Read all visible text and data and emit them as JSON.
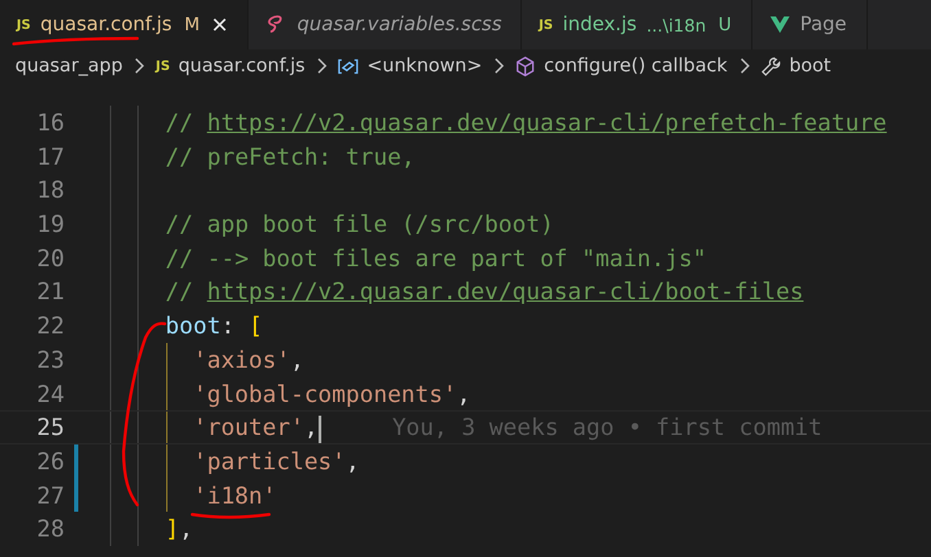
{
  "tabs": [
    {
      "kind": "js",
      "icon_label": "JS",
      "label": "quasar.conf.js",
      "italic": false,
      "selected": true,
      "decoration": "M",
      "color": "#e2c08d"
    },
    {
      "kind": "scss",
      "label": "quasar.variables.scss",
      "italic": true,
      "selected": false
    },
    {
      "kind": "js",
      "icon_label": "JS",
      "label": "index.js",
      "italic": false,
      "selected": false,
      "description": "...\\i18n",
      "decoration": "U",
      "color": "#73c991"
    },
    {
      "kind": "vue",
      "label": "Page",
      "italic": false,
      "selected": false
    }
  ],
  "breadcrumb": [
    {
      "kind": "folder",
      "label": "quasar_app"
    },
    {
      "kind": "js",
      "icon_label": "JS",
      "label": "quasar.conf.js"
    },
    {
      "kind": "variable",
      "label": "<unknown>"
    },
    {
      "kind": "method",
      "label": "configure() callback"
    },
    {
      "kind": "property",
      "label": "boot"
    }
  ],
  "lines": [
    {
      "number": "16",
      "modified": false,
      "current": false,
      "scope_guide": false,
      "tokens": [
        {
          "kind": "comment",
          "text": "    // "
        },
        {
          "kind": "link",
          "text": "https://v2.quasar.dev/quasar-cli/prefetch-feature"
        }
      ]
    },
    {
      "number": "17",
      "modified": false,
      "current": false,
      "scope_guide": false,
      "tokens": [
        {
          "kind": "comment",
          "text": "    // preFetch: true,"
        }
      ]
    },
    {
      "number": "18",
      "modified": false,
      "current": false,
      "scope_guide": false
    },
    {
      "number": "19",
      "modified": false,
      "current": false,
      "scope_guide": false,
      "tokens": [
        {
          "kind": "comment",
          "text": "    // app boot file (/src/boot)"
        }
      ]
    },
    {
      "number": "20",
      "modified": false,
      "current": false,
      "scope_guide": false,
      "tokens": [
        {
          "kind": "comment",
          "text": "    // --> boot files are part of \"main.js\""
        }
      ]
    },
    {
      "number": "21",
      "modified": false,
      "current": false,
      "scope_guide": false,
      "tokens": [
        {
          "kind": "comment",
          "text": "    // "
        },
        {
          "kind": "link",
          "text": "https://v2.quasar.dev/quasar-cli/boot-files"
        }
      ]
    },
    {
      "number": "22",
      "modified": false,
      "current": false,
      "scope_guide": false,
      "tokens": [
        {
          "kind": "key",
          "text": "    boot"
        },
        {
          "kind": "punct",
          "text": ": "
        },
        {
          "kind": "bracket",
          "text": "["
        }
      ]
    },
    {
      "number": "23",
      "modified": false,
      "current": false,
      "scope_guide": true,
      "tokens": [
        {
          "kind": "string",
          "text": "      'axios'"
        },
        {
          "kind": "punct",
          "text": ","
        }
      ]
    },
    {
      "number": "24",
      "modified": false,
      "current": false,
      "scope_guide": true,
      "tokens": [
        {
          "kind": "string",
          "text": "      'global-components'"
        },
        {
          "kind": "punct",
          "text": ","
        }
      ]
    },
    {
      "number": "25",
      "modified": false,
      "current": true,
      "scope_guide": true,
      "blame": "You, 3 weeks ago • first commit",
      "tokens": [
        {
          "kind": "string",
          "text": "      'router'"
        },
        {
          "kind": "punct",
          "text": ","
        }
      ]
    },
    {
      "number": "26",
      "modified": true,
      "current": false,
      "scope_guide": true,
      "tokens": [
        {
          "kind": "string",
          "text": "      'particles'"
        },
        {
          "kind": "punct",
          "text": ","
        }
      ]
    },
    {
      "number": "27",
      "modified": true,
      "current": false,
      "scope_guide": true,
      "tokens": [
        {
          "kind": "string",
          "text": "      'i18n'"
        }
      ]
    },
    {
      "number": "28",
      "modified": false,
      "current": false,
      "scope_guide": false,
      "tokens": [
        {
          "kind": "bracket",
          "text": "    ]"
        },
        {
          "kind": "punct",
          "text": ","
        }
      ]
    }
  ]
}
